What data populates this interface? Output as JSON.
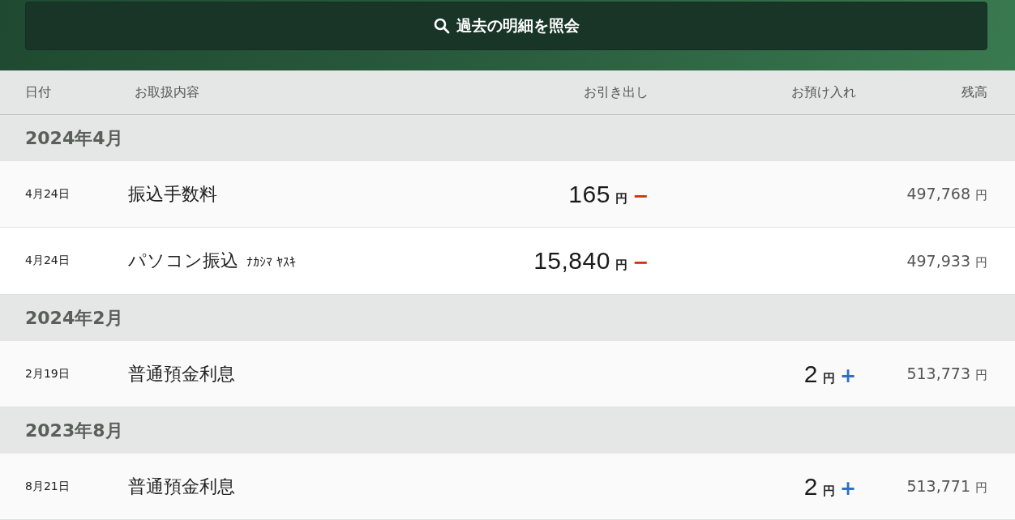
{
  "search_button": {
    "label": "過去の明細を照会"
  },
  "columns": [
    "日付",
    "お取扱内容",
    "お引き出し",
    "お預け入れ",
    "残高"
  ],
  "groups": [
    {
      "month": "2024年4月",
      "rows": [
        {
          "date": "4月24日",
          "description": "振込手数料",
          "amount": "165",
          "unit": "円",
          "kind": "withdrawal",
          "sign": "−",
          "balance": "497,768",
          "balance_unit": "円"
        },
        {
          "date": "4月24日",
          "description": "パソコン振込",
          "payee": "ﾅｶｼﾏ ﾔｽｷ",
          "amount": "15,840",
          "unit": "円",
          "kind": "withdrawal",
          "sign": "−",
          "balance": "497,933",
          "balance_unit": "円"
        }
      ]
    },
    {
      "month": "2024年2月",
      "rows": [
        {
          "date": "2月19日",
          "description": "普通預金利息",
          "amount": "2",
          "unit": "円",
          "kind": "deposit",
          "sign": "+",
          "balance": "513,773",
          "balance_unit": "円"
        }
      ]
    },
    {
      "month": "2023年8月",
      "rows": [
        {
          "date": "8月21日",
          "description": "普通預金利息",
          "amount": "2",
          "unit": "円",
          "kind": "deposit",
          "sign": "+",
          "balance": "513,771",
          "balance_unit": "円"
        }
      ]
    }
  ]
}
